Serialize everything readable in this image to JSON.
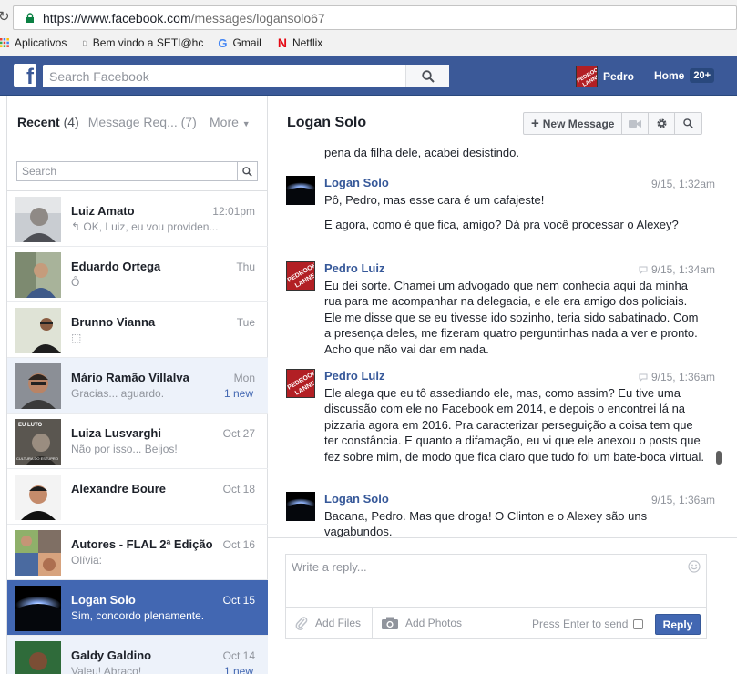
{
  "browser": {
    "url_prefix": "https://www.facebook.com",
    "url_path": "/messages/logansolo67",
    "bookmarks": [
      {
        "label": "Aplicativos",
        "icon": "apps-grid-icon"
      },
      {
        "label": "Bem vindo a SETI@hc",
        "icon": "page-icon"
      },
      {
        "label": "Gmail",
        "icon": "google-icon"
      },
      {
        "label": "Netflix",
        "icon": "netflix-icon"
      }
    ]
  },
  "fbbar": {
    "logo": "f",
    "search_placeholder": "Search Facebook",
    "profile_name": "Pedro",
    "home_label": "Home",
    "home_badge": "20+"
  },
  "left": {
    "tab_recent": "Recent",
    "tab_recent_count": "(4)",
    "tab_requests": "Message Req... (7)",
    "tab_more": "More",
    "search_placeholder": "Search",
    "conversations": [
      {
        "name": "Luiz Amato",
        "time": "12:01pm",
        "snippet": "↰ OK, Luiz, eu vou providen...",
        "badge": "",
        "state": "normal"
      },
      {
        "name": "Eduardo Ortega",
        "time": "Thu",
        "snippet": "Ô",
        "badge": "",
        "state": "normal"
      },
      {
        "name": "Brunno Vianna",
        "time": "Tue",
        "snippet": "⬚",
        "badge": "",
        "state": "normal"
      },
      {
        "name": "Mário Ramão Villalva",
        "time": "Mon",
        "snippet": "Gracias... aguardo.",
        "badge": "1 new",
        "state": "unread"
      },
      {
        "name": "Luiza Lusvarghi",
        "time": "Oct 27",
        "snippet": "Não por isso... Beijos!",
        "badge": "",
        "state": "normal"
      },
      {
        "name": "Alexandre Boure",
        "time": "Oct 18",
        "snippet": "",
        "badge": "",
        "state": "normal"
      },
      {
        "name": "Autores - FLAL 2ª Edição",
        "time": "Oct 16",
        "snippet": "Olívia:",
        "badge": "",
        "state": "normal"
      },
      {
        "name": "Logan Solo",
        "time": "Oct 15",
        "snippet": "Sim, concordo plenamente.",
        "badge": "",
        "state": "selected"
      },
      {
        "name": "Galdy Galdino",
        "time": "Oct 14",
        "snippet": "Valeu! Abraço!",
        "badge": "1 new",
        "state": "unread"
      }
    ]
  },
  "thread": {
    "title": "Logan Solo",
    "new_message_label": "New Message",
    "partial_text": "pena da filha dele, acabei desistindo.",
    "messages": [
      {
        "sender": "Logan Solo",
        "time": "9/15, 1:32am",
        "seen_icon": false,
        "paragraphs": [
          "Pô, Pedro, mas esse cara é um cafajeste!",
          "E agora, como é que fica, amigo? Dá pra você processar o Alexey?"
        ]
      },
      {
        "sender": "Pedro Luiz",
        "time": "9/15, 1:34am",
        "seen_icon": true,
        "paragraphs": [
          "Eu dei sorte. Chamei um advogado que nem conhecia aqui da minha rua para me acompanhar na delegacia, e ele era amigo dos policiais. Ele me disse que se eu tivesse ido sozinho, teria sido sabatinado. Com a presença deles, me fizeram quatro perguntinhas nada a ver e pronto. Acho que não vai dar em nada."
        ]
      },
      {
        "sender": "Pedro Luiz",
        "time": "9/15, 1:36am",
        "seen_icon": true,
        "paragraphs": [
          "Ele alega que eu tô assediando ele, mas, como assim? Eu tive uma discussão com ele no Facebook em 2014, e depois o encontrei lá na pizzaria agora em 2016. Pra caracterizar perseguição a coisa tem que ter constância. E quanto a difamação, eu vi que ele anexou o posts que fez sobre mim, de modo que fica claro que tudo foi um bate-boca virtual."
        ]
      },
      {
        "sender": "Logan Solo",
        "time": "9/15, 1:36am",
        "seen_icon": false,
        "paragraphs": [
          "Bacana, Pedro. Mas que droga! O Clinton e o Alexey são uns vagabundos."
        ]
      }
    ]
  },
  "composer": {
    "placeholder": "Write a reply...",
    "add_files": "Add Files",
    "add_photos": "Add Photos",
    "press_enter": "Press Enter to send",
    "reply_label": "Reply"
  },
  "avatar_text": {
    "pedroom_top": "PEDROOM",
    "pedroom_bottom": "LANNE",
    "luiza_top": "EU LUTO",
    "luiza_bottom": "CULTURA DO ESTUPRO"
  }
}
